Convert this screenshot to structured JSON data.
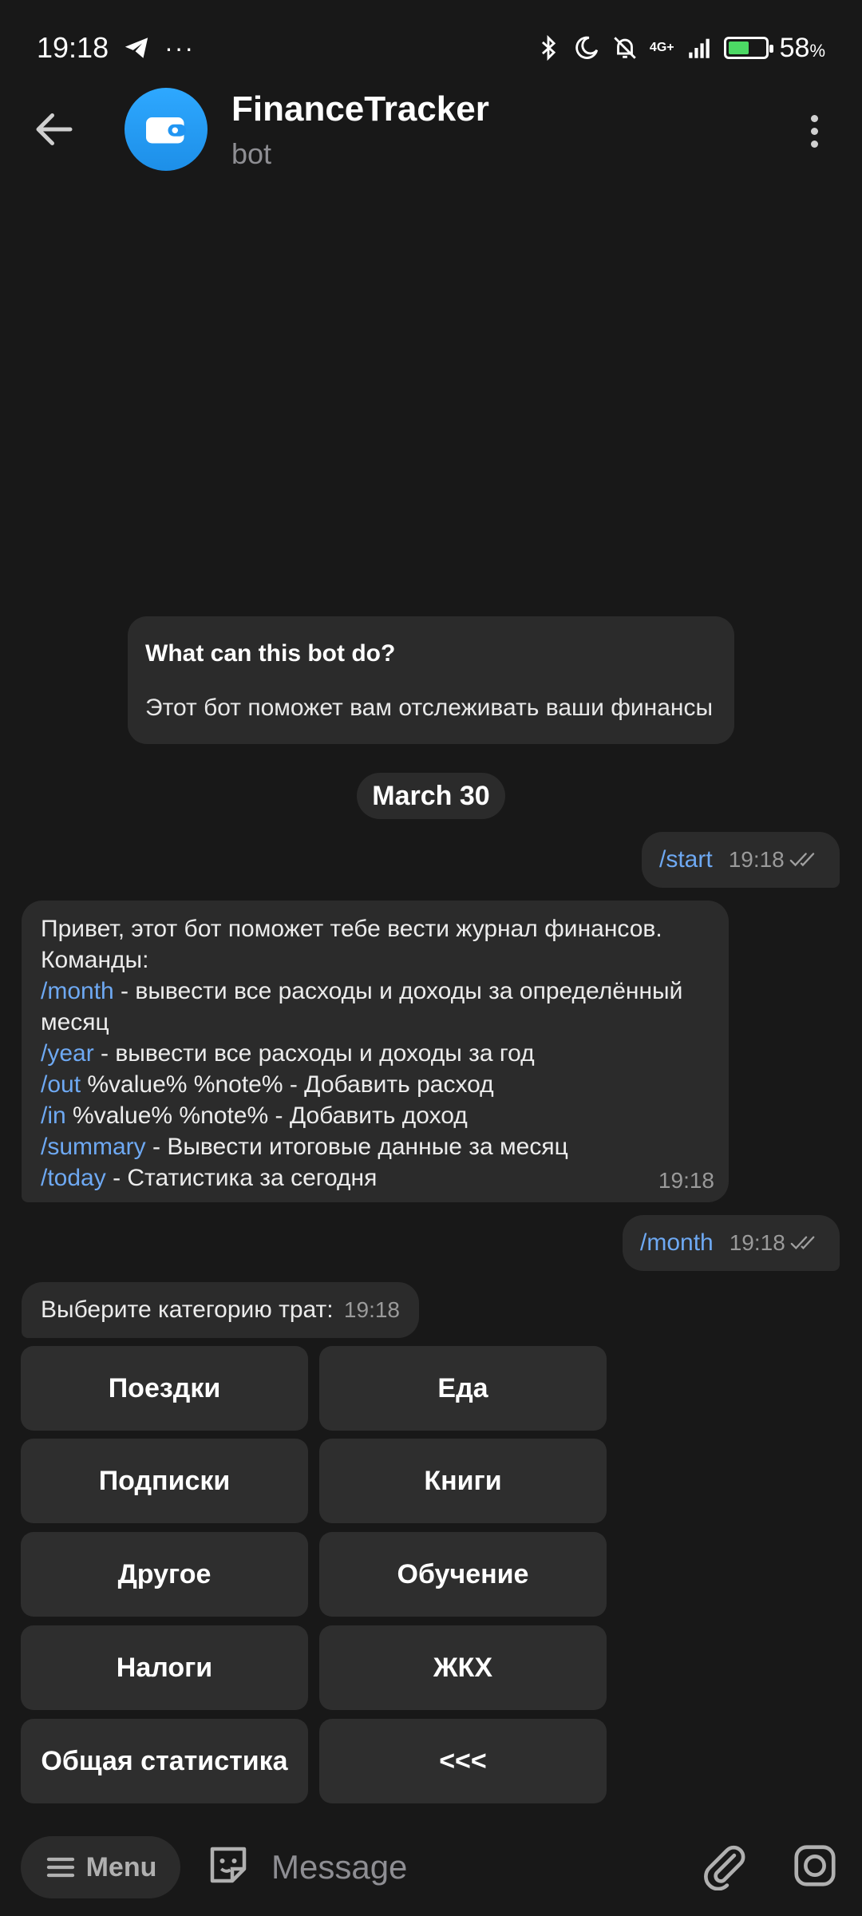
{
  "status_bar": {
    "time": "19:18",
    "network": "4G+",
    "battery_percent": "58",
    "battery_unit": "%",
    "battery_level": 0.58,
    "icons": [
      "telegram-icon",
      "more-notifications-icon",
      "bluetooth-icon",
      "do-not-disturb-icon",
      "muted-bell-icon",
      "signal-icon",
      "battery-icon"
    ]
  },
  "header": {
    "title": "FinanceTracker",
    "subtitle": "bot",
    "avatar_color": "#2196f3"
  },
  "intro": {
    "title": "What can this bot do?",
    "text": "Этот бот поможет вам отслеживать ваши финансы"
  },
  "date_divider": "March 30",
  "messages": [
    {
      "direction": "out",
      "text": "/start",
      "time": "19:18"
    },
    {
      "direction": "in",
      "lines": [
        {
          "plain": "Привет, этот бот поможет тебе вести журнал финансов."
        },
        {
          "plain": "Команды:"
        },
        {
          "cmd": "/month",
          "plain": " - вывести все расходы и доходы за определённый"
        },
        {
          "plain": "месяц"
        },
        {
          "cmd": "/year",
          "plain": " - вывести все расходы и доходы за год"
        },
        {
          "cmd": "/out",
          "plain": " %value% %note% - Добавить расход"
        },
        {
          "cmd": "/in",
          "plain": " %value% %note% - Добавить доход"
        },
        {
          "cmd": "/summary",
          "plain": " - Вывести итоговые данные за месяц"
        },
        {
          "cmd": "/today",
          "plain": " - Статистика за сегодня"
        }
      ],
      "time": "19:18"
    },
    {
      "direction": "out",
      "text": "/month",
      "time": "19:18"
    },
    {
      "direction": "in",
      "text": "Выберите категорию трат:",
      "time": "19:18"
    }
  ],
  "keyboard": [
    [
      "Поездки",
      "Еда"
    ],
    [
      "Подписки",
      "Книги"
    ],
    [
      "Другое",
      "Обучение"
    ],
    [
      "Налоги",
      "ЖКХ"
    ],
    [
      "Общая статистика",
      "<<<"
    ]
  ],
  "input_bar": {
    "menu_label": "Menu",
    "placeholder": "Message"
  },
  "colors": {
    "background": "#181818",
    "bubble": "#2b2b2b",
    "command_link": "#6ea9f3",
    "accent": "#2196f3"
  }
}
